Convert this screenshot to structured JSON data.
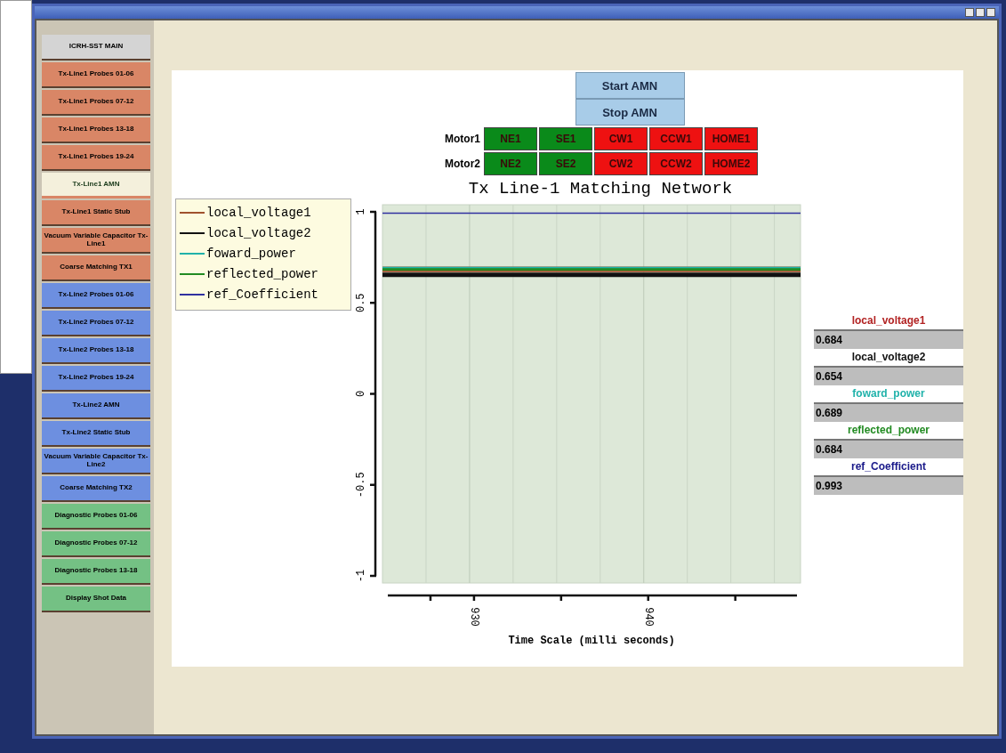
{
  "sidebar": {
    "items": [
      {
        "label": "ICRH-SST MAIN",
        "color": "#d4d4d4",
        "selected": false
      },
      {
        "label": "Tx-Line1 Probes 01-06",
        "color": "#d98666",
        "selected": false
      },
      {
        "label": "Tx-Line1 Probes 07-12",
        "color": "#d98666",
        "selected": false
      },
      {
        "label": "Tx-Line1 Probes 13-18",
        "color": "#d98666",
        "selected": false
      },
      {
        "label": "Tx-Line1 Probes 19-24",
        "color": "#d98666",
        "selected": false
      },
      {
        "label": "Tx-Line1 AMN",
        "color": "#d98666",
        "selected": true
      },
      {
        "label": "Tx-Line1 Static Stub",
        "color": "#d98666",
        "selected": false
      },
      {
        "label": "Vacuum Variable Capacitor Tx-Line1",
        "color": "#d98666",
        "selected": false
      },
      {
        "label": "Coarse Matching TX1",
        "color": "#d98666",
        "selected": false
      },
      {
        "label": "Tx-Line2 Probes 01-06",
        "color": "#6d8fe0",
        "selected": false
      },
      {
        "label": "Tx-Line2 Probes 07-12",
        "color": "#6d8fe0",
        "selected": false
      },
      {
        "label": "Tx-Line2 Probes 13-18",
        "color": "#6d8fe0",
        "selected": false
      },
      {
        "label": "Tx-Line2 Probes 19-24",
        "color": "#6d8fe0",
        "selected": false
      },
      {
        "label": "Tx-Line2 AMN",
        "color": "#6d8fe0",
        "selected": false
      },
      {
        "label": "Tx-Line2 Static Stub",
        "color": "#6d8fe0",
        "selected": false
      },
      {
        "label": "Vacuum Variable Capacitor Tx-Line2",
        "color": "#6d8fe0",
        "selected": false
      },
      {
        "label": "Coarse Matching TX2",
        "color": "#6d8fe0",
        "selected": false
      },
      {
        "label": "Diagnostic Probes 01-06",
        "color": "#74c184",
        "selected": false
      },
      {
        "label": "Diagnostic Probes 07-12",
        "color": "#74c184",
        "selected": false
      },
      {
        "label": "Diagnostic Probes 13-18",
        "color": "#74c184",
        "selected": false
      },
      {
        "label": "Display Shot Data",
        "color": "#74c184",
        "selected": false
      }
    ]
  },
  "controls": {
    "buttons": [
      "Start AMN",
      "Stop AMN"
    ],
    "motors": [
      {
        "label": "Motor1",
        "buttons": [
          {
            "label": "NE1",
            "color": "#0a8a1a"
          },
          {
            "label": "SE1",
            "color": "#0a8a1a"
          },
          {
            "label": "CW1",
            "color": "#ee1111"
          },
          {
            "label": "CCW1",
            "color": "#ee1111"
          },
          {
            "label": "HOME1",
            "color": "#ee1111"
          }
        ]
      },
      {
        "label": "Motor2",
        "buttons": [
          {
            "label": "NE2",
            "color": "#0a8a1a"
          },
          {
            "label": "SE2",
            "color": "#0a8a1a"
          },
          {
            "label": "CW2",
            "color": "#ee1111"
          },
          {
            "label": "CCW2",
            "color": "#ee1111"
          },
          {
            "label": "HOME2",
            "color": "#ee1111"
          }
        ]
      }
    ]
  },
  "chart": {
    "chart_data": {
      "type": "line",
      "title": "Tx Line-1 Matching Network",
      "xlabel": "Time Scale (milli seconds)",
      "x": [
        925,
        949
      ],
      "xlim": [
        925,
        949
      ],
      "ylim": [
        -1,
        1
      ],
      "xticks": [
        930,
        940
      ],
      "yticks": [
        -1,
        -0.5,
        0,
        0.5,
        1
      ],
      "series": [
        {
          "name": "local_voltage1",
          "color": "#a0522d",
          "values": [
            0.684,
            0.684
          ]
        },
        {
          "name": "local_voltage2",
          "color": "#111111",
          "values": [
            0.654,
            0.654
          ]
        },
        {
          "name": "foward_power",
          "color": "#20b2aa",
          "values": [
            0.689,
            0.689
          ]
        },
        {
          "name": "reflected_power",
          "color": "#228b22",
          "values": [
            0.684,
            0.684
          ]
        },
        {
          "name": "ref_Coefficient",
          "color": "#3030a0",
          "values": [
            0.993,
            0.993
          ]
        }
      ]
    }
  },
  "readouts": [
    {
      "label": "local_voltage1",
      "value": "0.684",
      "color": "#b22222"
    },
    {
      "label": "local_voltage2",
      "value": "0.654",
      "color": "#111111"
    },
    {
      "label": "foward_power",
      "value": "0.689",
      "color": "#20b2aa"
    },
    {
      "label": "reflected_power",
      "value": "0.684",
      "color": "#228b22"
    },
    {
      "label": "ref_Coefficient",
      "value": "0.993",
      "color": "#1a1a8a"
    }
  ]
}
